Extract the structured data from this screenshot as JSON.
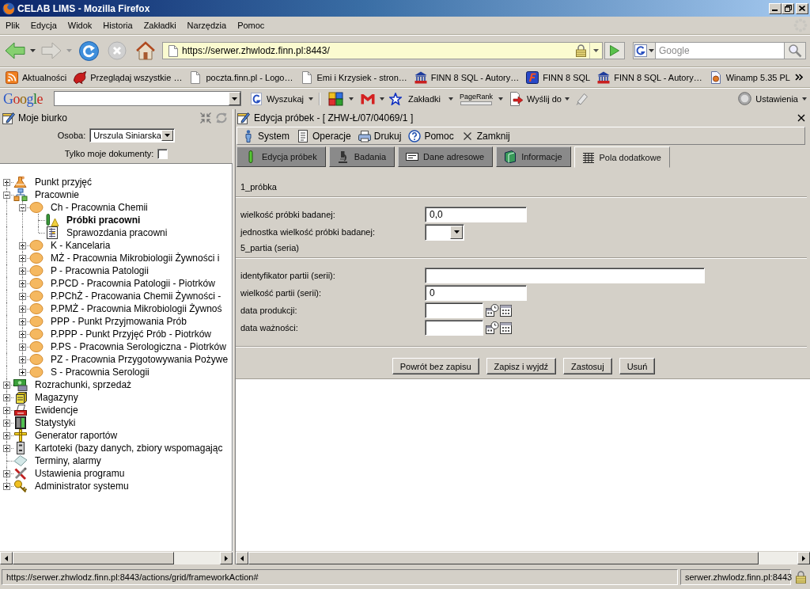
{
  "window": {
    "title": "CELAB LIMS - Mozilla Firefox"
  },
  "menu_bar": [
    "Plik",
    "Edycja",
    "Widok",
    "Historia",
    "Zakładki",
    "Narzędzia",
    "Pomoc"
  ],
  "navigation": {
    "url": "https://serwer.zhwlodz.finn.pl:8443/",
    "search_placeholder": "Google"
  },
  "bookmarks": [
    {
      "label": "Aktualności",
      "kind": "feed"
    },
    {
      "label": "Przeglądaj wszystkie …",
      "kind": "dragon"
    },
    {
      "label": "poczta.finn.pl - Logo…",
      "kind": "page"
    },
    {
      "label": "Emi i Krzysiek - stron…",
      "kind": "page"
    },
    {
      "label": "FINN 8 SQL - Autory…",
      "kind": "bank"
    },
    {
      "label": "FINN 8 SQL",
      "kind": "finn"
    },
    {
      "label": "FINN 8 SQL - Autory…",
      "kind": "bank"
    },
    {
      "label": "Winamp 5.35 PL",
      "kind": "winamp"
    }
  ],
  "google_toolbar": {
    "logo": "Google",
    "search_button": "Wyszukaj",
    "bookmarks_button": "Zakładki",
    "pagerank": "PageRank",
    "send_button": "Wyślij do",
    "settings_button": "Ustawienia"
  },
  "desk_panel": {
    "title": "Moje biurko",
    "person_label": "Osoba:",
    "person": "Urszula Siniarska",
    "only_mine": {
      "label": "Tylko moje dokumenty:",
      "checked": false
    },
    "tree": [
      {
        "label": "Punkt przyjęć",
        "kind": "intake",
        "expanded": false,
        "selected": false
      },
      {
        "label": "Pracownie",
        "kind": "labs",
        "expanded": true,
        "selected": false,
        "children": [
          {
            "label": "Ch - Pracownia Chemii",
            "kind": "lab",
            "expanded": true,
            "selected": false,
            "children": [
              {
                "label": "Próbki pracowni",
                "kind": "samples",
                "selected": true
              },
              {
                "label": "Sprawozdania pracowni",
                "kind": "reports",
                "selected": false
              }
            ]
          },
          {
            "label": "K - Kancelaria",
            "kind": "lab",
            "expanded": false,
            "selected": false
          },
          {
            "label": "MŻ - Pracownia Mikrobiologii Żywności i",
            "kind": "lab",
            "expanded": false,
            "selected": false
          },
          {
            "label": "P - Pracownia Patologii",
            "kind": "lab",
            "expanded": false,
            "selected": false
          },
          {
            "label": "P.PCD - Pracownia Patologii - Piotrków",
            "kind": "lab",
            "expanded": false,
            "selected": false
          },
          {
            "label": "P.PChŻ - Pracowania Chemii Żywności -",
            "kind": "lab",
            "expanded": false,
            "selected": false
          },
          {
            "label": "P.PMŻ - Pracownia Mikrobiologii Żywnoś",
            "kind": "lab",
            "expanded": false,
            "selected": false
          },
          {
            "label": "PPP - Punkt Przyjmowania Prób",
            "kind": "lab",
            "expanded": false,
            "selected": false
          },
          {
            "label": "P.PPP - Punkt Przyjęć Prób - Piotrków",
            "kind": "lab",
            "expanded": false,
            "selected": false
          },
          {
            "label": "P.PS - Pracownia Serologiczna - Piotrków",
            "kind": "lab",
            "expanded": false,
            "selected": false
          },
          {
            "label": "PZ - Pracownia Przygotowywania Pożywe",
            "kind": "lab",
            "expanded": false,
            "selected": false
          },
          {
            "label": "S - Pracownia Serologii",
            "kind": "lab",
            "expanded": false,
            "selected": false
          }
        ]
      },
      {
        "label": "Rozrachunki, sprzedaż",
        "kind": "accounts",
        "expanded": false,
        "selected": false
      },
      {
        "label": "Magazyny",
        "kind": "warehouse",
        "expanded": false,
        "selected": false
      },
      {
        "label": "Ewidencje",
        "kind": "records",
        "expanded": false,
        "selected": false
      },
      {
        "label": "Statystyki",
        "kind": "stats",
        "expanded": false,
        "selected": false
      },
      {
        "label": "Generator raportów",
        "kind": "generator",
        "expanded": false,
        "selected": false
      },
      {
        "label": "Kartoteki (bazy danych, zbiory wspomagając",
        "kind": "files",
        "expanded": false,
        "selected": false
      },
      {
        "label": "Terminy, alarmy",
        "kind": "alarms",
        "selected": false
      },
      {
        "label": "Ustawienia programu",
        "kind": "settings",
        "expanded": false,
        "selected": false
      },
      {
        "label": "Administrator systemu",
        "kind": "admin",
        "expanded": false,
        "selected": false
      }
    ]
  },
  "editor": {
    "title": "Edycja próbek - [ ZHW-Ł/07/04069/1 ]",
    "menu": [
      {
        "label": "System",
        "kind": "system"
      },
      {
        "label": "Operacje",
        "kind": "operations"
      },
      {
        "label": "Drukuj",
        "kind": "print"
      },
      {
        "label": "Pomoc",
        "kind": "help"
      },
      {
        "label": "Zamknij",
        "kind": "close"
      }
    ],
    "tabs": [
      {
        "label": "Edycja próbek",
        "kind": "tube",
        "selected": false
      },
      {
        "label": "Badania",
        "kind": "microscope",
        "selected": false
      },
      {
        "label": "Dane adresowe",
        "kind": "card",
        "selected": false
      },
      {
        "label": "Informacje",
        "kind": "book",
        "selected": false
      },
      {
        "label": "Pola dodatkowe",
        "kind": "grid",
        "selected": true
      }
    ],
    "sections": [
      {
        "title": "1_próbka",
        "fields": [
          {
            "label": "wielkość próbki badanej:",
            "kind": "text",
            "value": "0,0"
          },
          {
            "label": "jednostka wielkość próbki badanej:",
            "kind": "select"
          }
        ]
      },
      {
        "title": "5_partia (seria)",
        "fields": [
          {
            "label": "identyfikator partii (serii):",
            "kind": "long_text"
          },
          {
            "label": "wielkość partii (serii):",
            "kind": "text",
            "value": "0"
          },
          {
            "label": "data produkcji:",
            "kind": "date"
          },
          {
            "label": "data ważności:",
            "kind": "date"
          }
        ]
      }
    ],
    "buttons": [
      "Powrót bez zapisu",
      "Zapisz i wyjdź",
      "Zastosuj",
      "Usuń"
    ]
  },
  "status_bar": {
    "url": "https://serwer.zhwlodz.finn.pl:8443/actions/grid/frameworkAction#",
    "host": "serwer.zhwlodz.finn.pl:8443"
  }
}
